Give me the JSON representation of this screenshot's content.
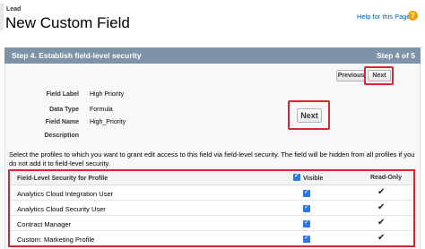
{
  "header": {
    "object_label": "Lead",
    "title": "New Custom Field",
    "help_link": "Help for this Page",
    "help_icon": "help-icon"
  },
  "step": {
    "title": "Step 4. Establish field-level security",
    "count": "Step 4 of 5"
  },
  "buttons": {
    "previous": "Previous",
    "next": "Next",
    "next_zoom": "Next"
  },
  "field_props": [
    {
      "label": "Field Label",
      "value": "High Priority"
    },
    {
      "label": "Data Type",
      "value": "Formula"
    },
    {
      "label": "Field Name",
      "value": "High_Priority"
    },
    {
      "label": "Description",
      "value": ""
    }
  ],
  "instructions": "Select the profiles to which you want to grant edit access to this field via field-level security. The field will be hidden from all profiles if you do not add it to field-level security.",
  "fls_table": {
    "columns": {
      "profile": "Field-Level Security for Profile",
      "visible": "Visible",
      "read_only": "Read-Only"
    },
    "rows": [
      {
        "profile": "Analytics Cloud Integration User",
        "visible": true,
        "read_only": true
      },
      {
        "profile": "Analytics Cloud Security User",
        "visible": true,
        "read_only": true
      },
      {
        "profile": "Contract Manager",
        "visible": true,
        "read_only": true
      },
      {
        "profile": "Custom: Marketing Profile",
        "visible": true,
        "read_only": true
      }
    ]
  },
  "colors": {
    "step_bar": "#7e93a7",
    "highlight": "#d9282f",
    "checkbox": "#2b78e4",
    "link": "#015ba7"
  }
}
